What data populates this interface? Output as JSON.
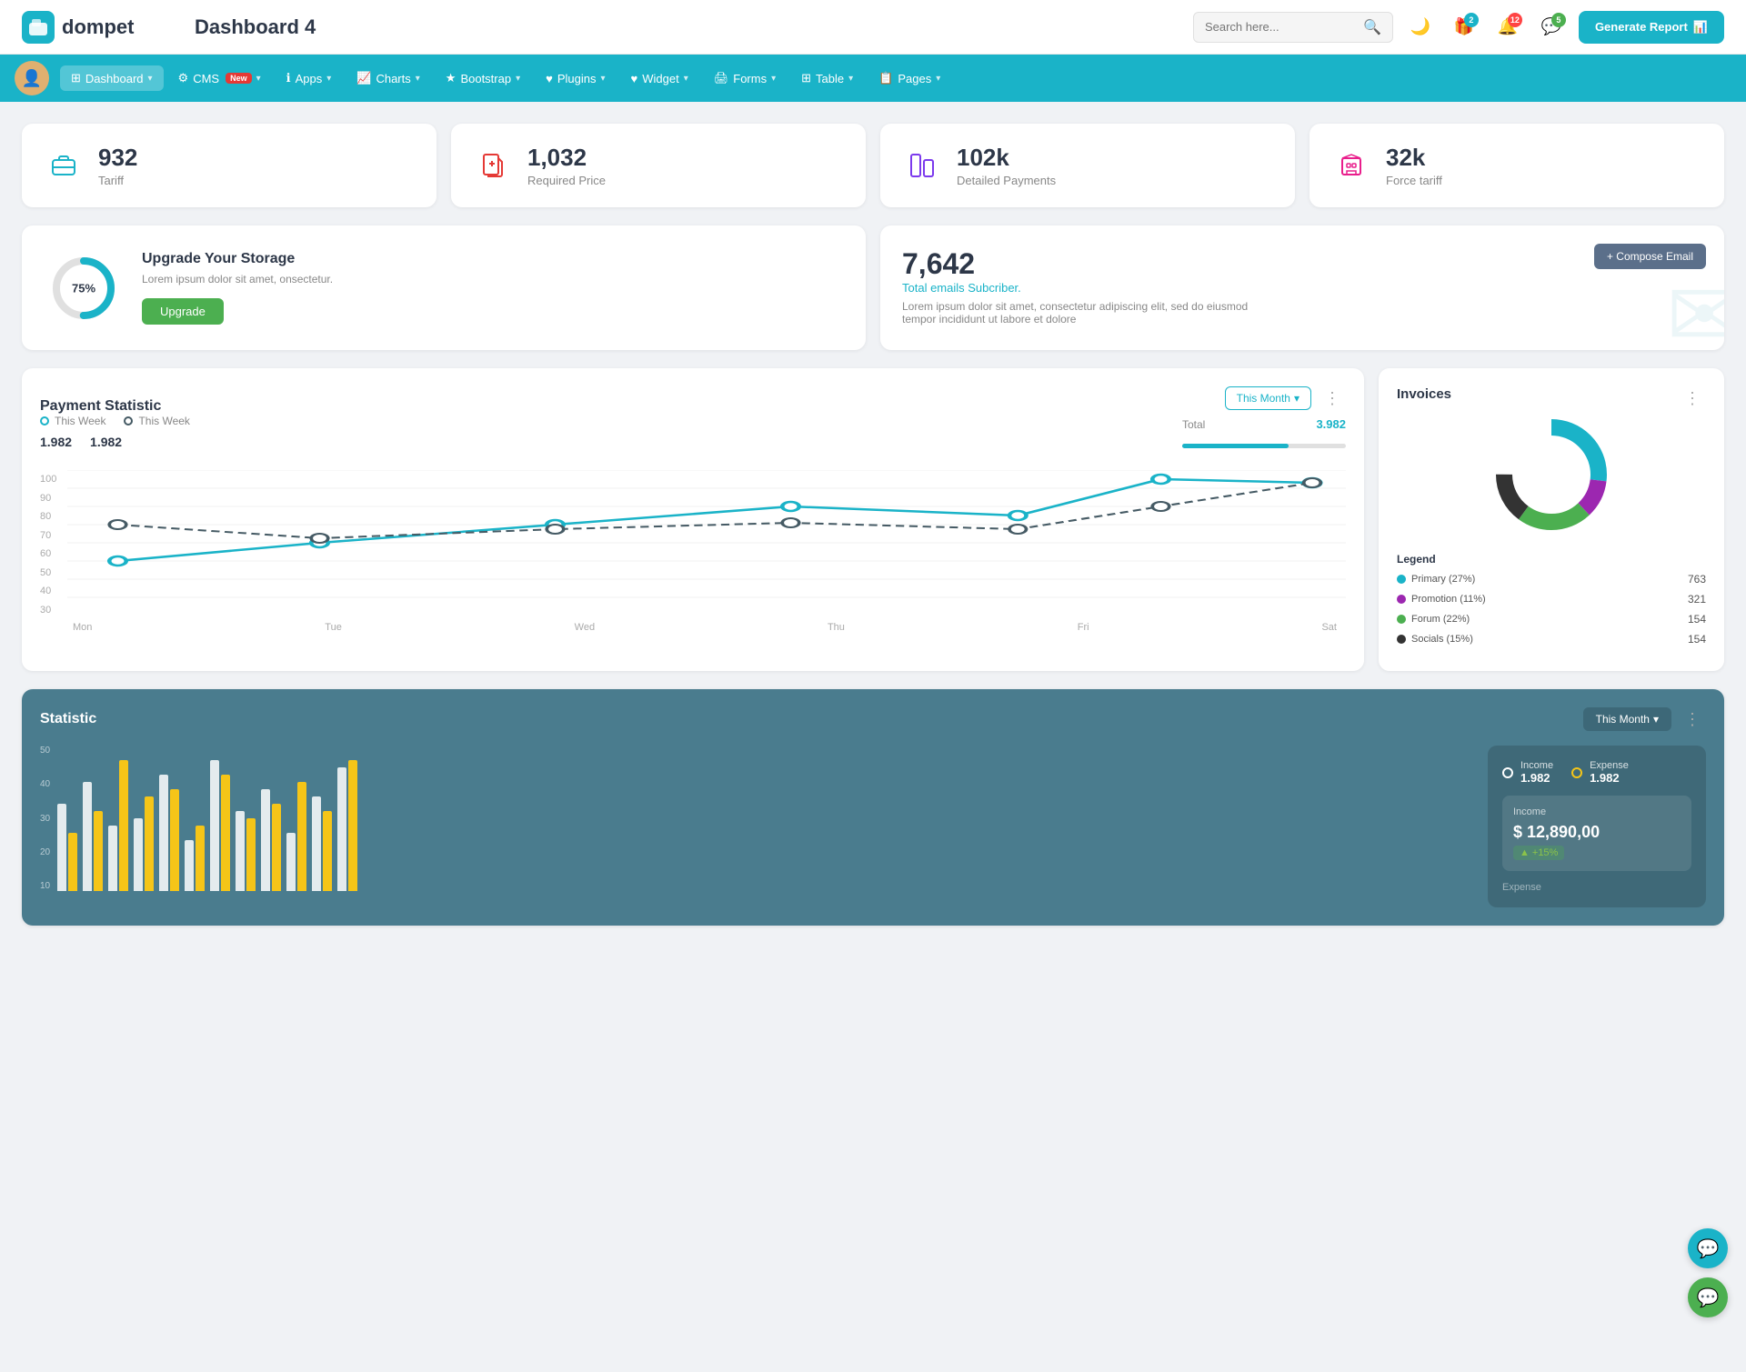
{
  "header": {
    "logo_text": "dompet",
    "page_title": "Dashboard 4",
    "search_placeholder": "Search here...",
    "generate_btn": "Generate Report",
    "icons": {
      "moon": "🌙",
      "gift": "🎁",
      "bell": "🔔",
      "chat": "💬"
    },
    "badges": {
      "gift": "2",
      "bell": "12",
      "chat": "5"
    }
  },
  "navbar": {
    "items": [
      {
        "label": "Dashboard",
        "active": true,
        "has_dropdown": true
      },
      {
        "label": "CMS",
        "has_dropdown": true,
        "is_new": true
      },
      {
        "label": "Apps",
        "has_dropdown": true
      },
      {
        "label": "Charts",
        "has_dropdown": true
      },
      {
        "label": "Bootstrap",
        "has_dropdown": true
      },
      {
        "label": "Plugins",
        "has_dropdown": true
      },
      {
        "label": "Widget",
        "has_dropdown": true
      },
      {
        "label": "Forms",
        "has_dropdown": true
      },
      {
        "label": "Table",
        "has_dropdown": true
      },
      {
        "label": "Pages",
        "has_dropdown": true
      }
    ]
  },
  "stat_cards": [
    {
      "value": "932",
      "label": "Tariff",
      "icon": "briefcase",
      "color": "teal"
    },
    {
      "value": "1,032",
      "label": "Required Price",
      "icon": "file-plus",
      "color": "red"
    },
    {
      "value": "102k",
      "label": "Detailed Payments",
      "icon": "chart",
      "color": "purple"
    },
    {
      "value": "32k",
      "label": "Force tariff",
      "icon": "building",
      "color": "pink"
    }
  ],
  "upgrade_card": {
    "percent": "75%",
    "title": "Upgrade Your Storage",
    "desc": "Lorem ipsum dolor sit amet, onsectetur.",
    "btn_label": "Upgrade"
  },
  "email_card": {
    "number": "7,642",
    "subtitle": "Total emails Subcriber.",
    "desc": "Lorem ipsum dolor sit amet, consectetur adipiscing elit, sed do eiusmod tempor incididunt ut labore et dolore",
    "compose_btn": "+ Compose Email"
  },
  "payment_statistic": {
    "title": "Payment Statistic",
    "this_month_btn": "This Month",
    "legend": [
      {
        "label": "This Week",
        "value": "1.982",
        "color": "teal"
      },
      {
        "label": "This Week",
        "value": "1.982",
        "color": "dark"
      }
    ],
    "total_label": "Total",
    "total_value": "3.982",
    "x_labels": [
      "Mon",
      "Tue",
      "Wed",
      "Thu",
      "Fri",
      "Sat"
    ],
    "y_labels": [
      "100",
      "90",
      "80",
      "70",
      "60",
      "50",
      "40",
      "30"
    ],
    "line1_points": "40,150 150,120 280,100 410,80 545,90 680,30 780,35",
    "line2_points": "40,110 150,125 280,110 410,105 545,110 680,75 780,35"
  },
  "invoices": {
    "title": "Invoices",
    "donut": {
      "segments": [
        {
          "label": "Primary (27%)",
          "color": "#1ab3c8",
          "value": "763",
          "percent": 27
        },
        {
          "label": "Promotion (11%)",
          "color": "#9c27b0",
          "value": "321",
          "percent": 11
        },
        {
          "label": "Forum (22%)",
          "color": "#4caf50",
          "value": "154",
          "percent": 22
        },
        {
          "label": "Socials (15%)",
          "color": "#333",
          "value": "154",
          "percent": 15
        }
      ]
    },
    "legend_title": "Legend"
  },
  "statistic": {
    "title": "Statistic",
    "this_month_btn": "This Month",
    "y_labels": [
      "50",
      "40",
      "30",
      "20",
      "10"
    ],
    "income": {
      "label": "Income",
      "value": "1.982",
      "amount": "$ 12,890,00",
      "badge": "+15%"
    },
    "expense": {
      "label": "Expense",
      "value": "1.982"
    },
    "bars": [
      {
        "white": 60,
        "yellow": 40
      },
      {
        "white": 75,
        "yellow": 55
      },
      {
        "white": 45,
        "yellow": 90
      },
      {
        "white": 50,
        "yellow": 65
      },
      {
        "white": 80,
        "yellow": 70
      },
      {
        "white": 35,
        "yellow": 45
      },
      {
        "white": 90,
        "yellow": 80
      },
      {
        "white": 55,
        "yellow": 50
      },
      {
        "white": 70,
        "yellow": 60
      },
      {
        "white": 40,
        "yellow": 75
      },
      {
        "white": 65,
        "yellow": 55
      },
      {
        "white": 85,
        "yellow": 90
      }
    ]
  },
  "month_label": "Month"
}
